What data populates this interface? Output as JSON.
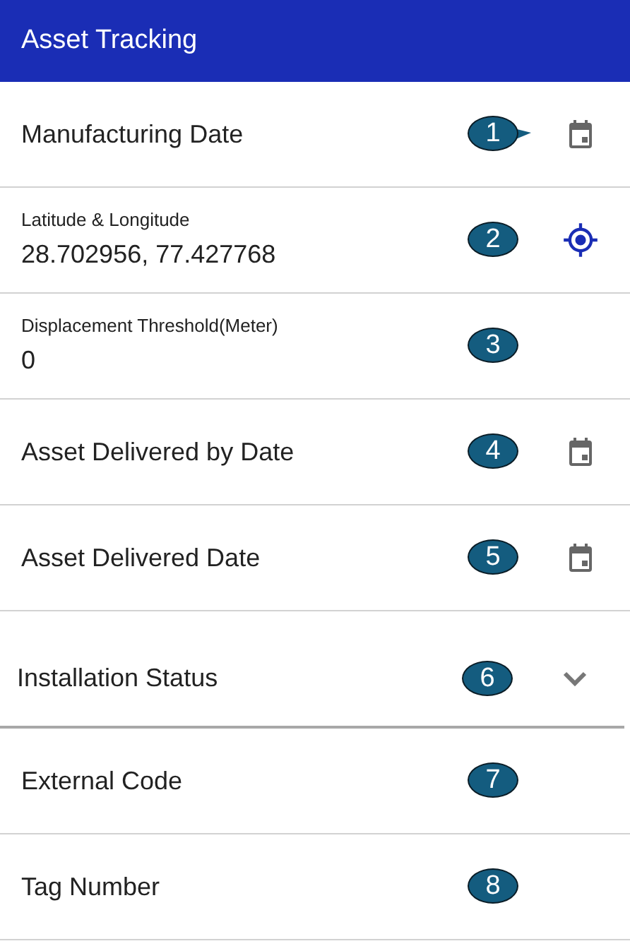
{
  "app_bar": {
    "title": "Asset Tracking"
  },
  "fields": [
    {
      "kind": "date",
      "label": "Manufacturing Date",
      "callout": "1",
      "pointer": true
    },
    {
      "kind": "location",
      "label": "Latitude & Longitude",
      "value": "28.702956, 77.427768",
      "callout": "2",
      "pointer": false
    },
    {
      "kind": "text",
      "label": "Displacement Threshold(Meter)",
      "value": "0",
      "callout": "3",
      "pointer": false
    },
    {
      "kind": "date",
      "label": "Asset Delivered by Date",
      "callout": "4",
      "pointer": false
    },
    {
      "kind": "date",
      "label": "Asset Delivered Date",
      "callout": "5",
      "pointer": false
    },
    {
      "kind": "dropdown",
      "label": "Installation Status",
      "callout": "6",
      "pointer": false
    },
    {
      "kind": "plain",
      "label": "External Code",
      "callout": "7",
      "pointer": false
    },
    {
      "kind": "plain",
      "label": "Tag Number",
      "callout": "8",
      "pointer": false
    }
  ]
}
